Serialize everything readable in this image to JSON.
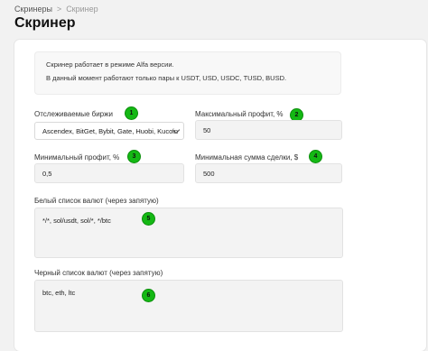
{
  "breadcrumb": {
    "parent": "Скринеры",
    "separator": ">",
    "current": "Скринер"
  },
  "page": {
    "title": "Скринер"
  },
  "info": {
    "line1": "Скринер работает в режиме Alfa версии.",
    "line2": "В данный момент работают только пары к USDT, USD, USDC, TUSD, BUSD."
  },
  "fields": {
    "exchanges": {
      "label": "Отслеживаемые биржи",
      "value": "Ascendex, BitGet, Bybit, Gate, Huobi, Kucoin",
      "badge": "1"
    },
    "max_profit": {
      "label": "Максимальный профит, %",
      "value": "50",
      "badge": "2"
    },
    "min_profit": {
      "label": "Минимальный профит, %",
      "value": "0,5",
      "badge": "3"
    },
    "min_deal": {
      "label": "Минимальная сумма сделки, $",
      "value": "500",
      "badge": "4"
    },
    "whitelist": {
      "label": "Белый список валют (через запятую)",
      "value": "*/*, sol/usdt, sol/*, */btc",
      "badge": "5"
    },
    "blacklist": {
      "label": "Черный список валют (через запятую)",
      "value": "btc, eth, ltc",
      "badge": "6"
    }
  },
  "colors": {
    "badge": "#14b814",
    "page_bg": "#f2f2f2",
    "card_bg": "#ffffff"
  }
}
